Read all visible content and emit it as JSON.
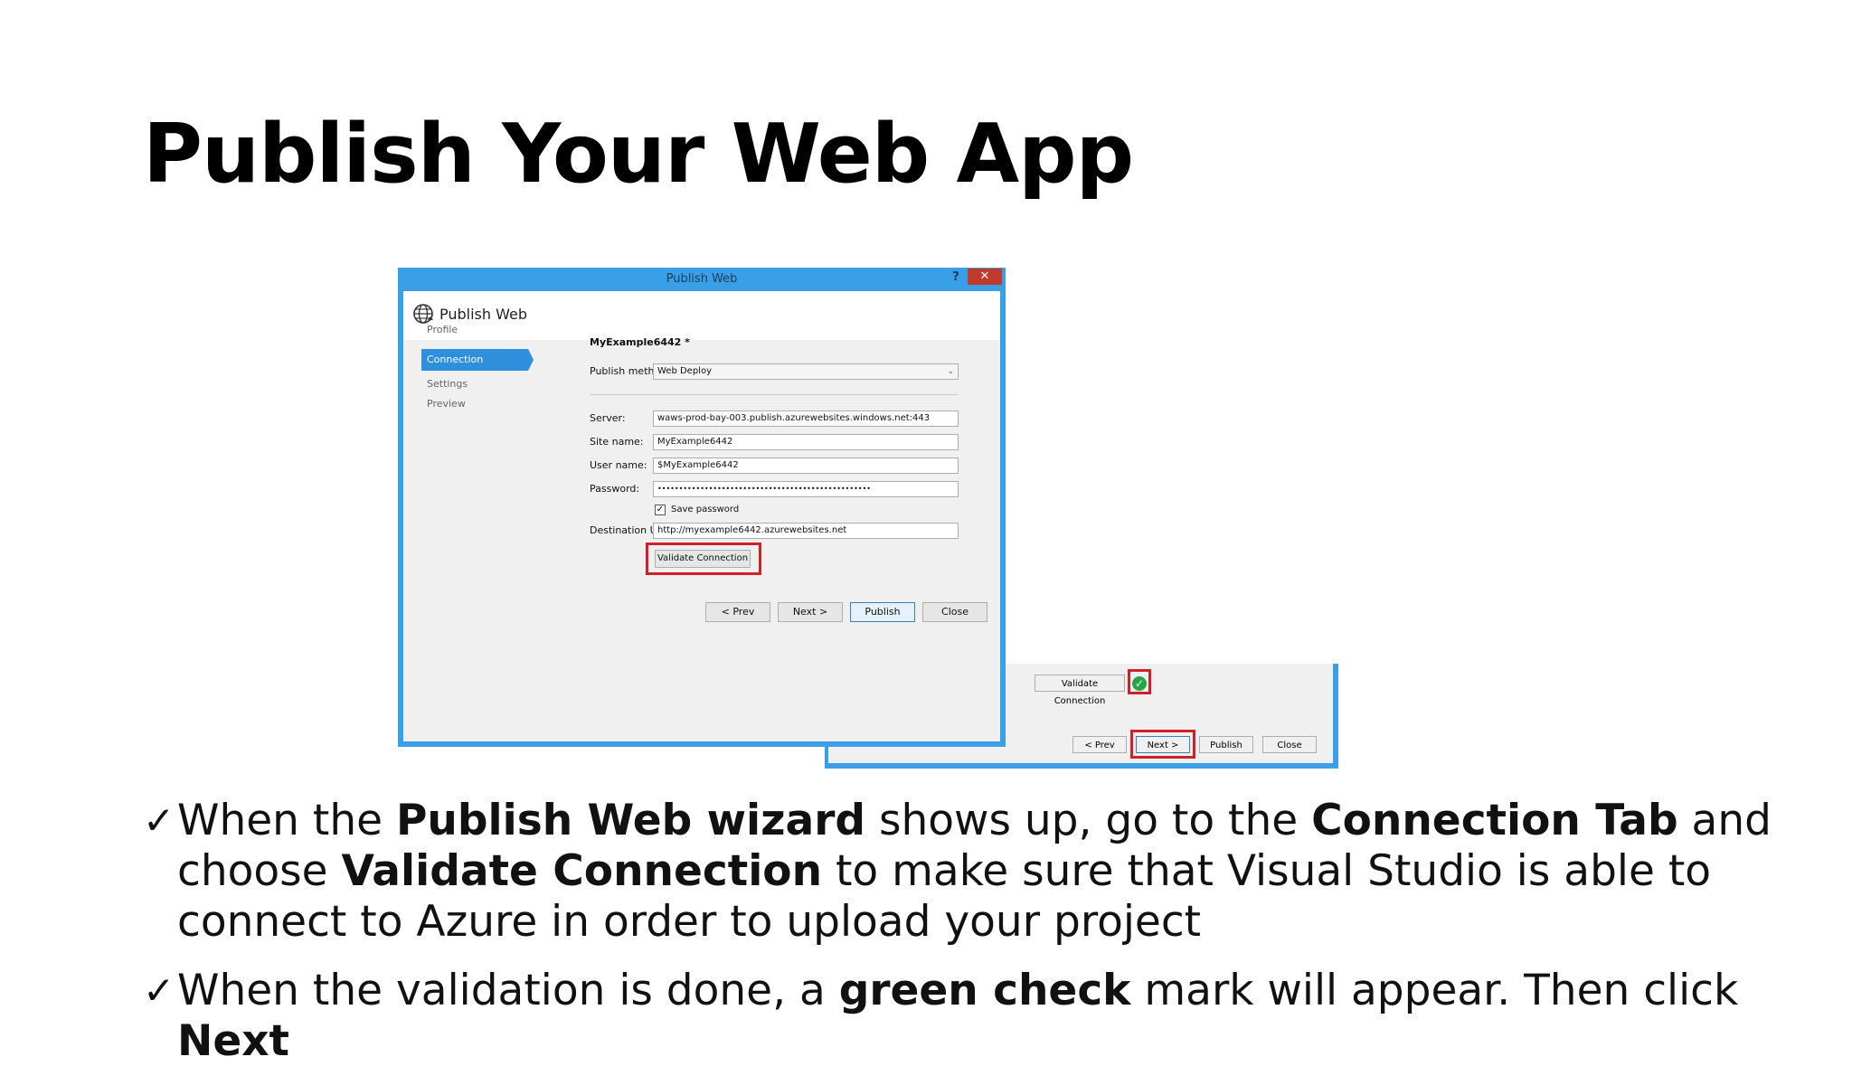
{
  "slide": {
    "title": "Publish Your Web App"
  },
  "dialog": {
    "window_title": "Publish Web",
    "help": "?",
    "close": "✕",
    "header": "Publish Web",
    "nav": [
      "Profile",
      "Connection",
      "Settings",
      "Preview"
    ],
    "profile_name": "MyExample6442 *",
    "publish_method_label": "Publish method:",
    "publish_method_value": "Web Deploy",
    "server_label": "Server:",
    "server_value": "waws-prod-bay-003.publish.azurewebsites.windows.net:443",
    "site_name_label": "Site name:",
    "site_name_value": "MyExample6442",
    "user_name_label": "User name:",
    "user_name_value": "$MyExample6442",
    "password_label": "Password:",
    "password_value": "••••••••••••••••••••••••••••••••••••••••••••••••••",
    "save_password_label": "Save password",
    "destination_url_label": "Destination URL:",
    "destination_url_value": "http://myexample6442.azurewebsites.net",
    "validate_button": "Validate Connection",
    "prev_button": "< Prev",
    "next_button": "Next >",
    "publish_button": "Publish",
    "close_button": "Close"
  },
  "partial_dialog": {
    "validate_button": "Validate Connection",
    "prev_button": "< Prev",
    "next_button": "Next >",
    "publish_button": "Publish",
    "close_button": "Close"
  },
  "bullets": [
    {
      "parts": [
        {
          "t": "When the ",
          "b": false
        },
        {
          "t": "Publish Web wizard",
          "b": true
        },
        {
          "t": " shows up, go to the ",
          "b": false
        },
        {
          "t": "Connection Tab",
          "b": true
        },
        {
          "t": " and choose ",
          "b": false
        },
        {
          "t": "Validate Connection",
          "b": true
        },
        {
          "t": " to make sure that Visual Studio is able to connect to Azure in order to upload your project",
          "b": false
        }
      ]
    },
    {
      "parts": [
        {
          "t": "When the validation is done, a ",
          "b": false
        },
        {
          "t": "green check",
          "b": true
        },
        {
          "t": " mark will appear. Then click ",
          "b": false
        },
        {
          "t": "Next",
          "b": true
        }
      ]
    }
  ],
  "colors": {
    "dialog_border": "#39a0e8",
    "nav_active": "#2e8fdd",
    "highlight": "#d0202a",
    "check": "#27a744"
  }
}
